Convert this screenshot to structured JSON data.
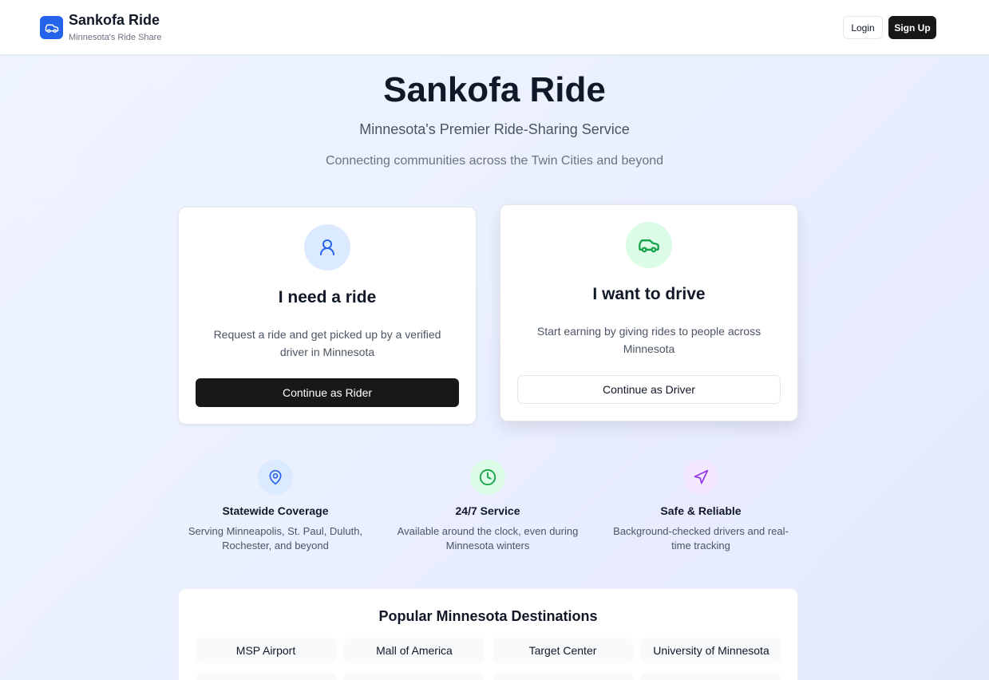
{
  "header": {
    "brand_name": "Sankofa Ride",
    "brand_tagline": "Minnesota's Ride Share",
    "logo_icon": "car-icon",
    "login_label": "Login",
    "signup_label": "Sign Up"
  },
  "hero": {
    "title": "Sankofa Ride",
    "subtitle": "Minnesota's Premier Ride-Sharing Service",
    "description": "Connecting communities across the Twin Cities and beyond"
  },
  "cards": {
    "rider": {
      "icon": "user-icon",
      "title": "I need a ride",
      "text": "Request a ride and get picked up by a verified driver in Minnesota",
      "button": "Continue as Rider"
    },
    "driver": {
      "icon": "car-icon",
      "title": "I want to drive",
      "text": "Start earning by giving rides to people across Minnesota",
      "button": "Continue as Driver"
    }
  },
  "features": [
    {
      "icon": "map-pin-icon",
      "title": "Statewide Coverage",
      "text": "Serving Minneapolis, St. Paul, Duluth, Rochester, and beyond"
    },
    {
      "icon": "clock-icon",
      "title": "24/7 Service",
      "text": "Available around the clock, even during Minnesota winters"
    },
    {
      "icon": "navigation-icon",
      "title": "Safe & Reliable",
      "text": "Background-checked drivers and real-time tracking"
    }
  ],
  "destinations": {
    "title": "Popular Minnesota Destinations",
    "items": [
      "MSP Airport",
      "Mall of America",
      "Target Center",
      "University of Minnesota"
    ]
  },
  "colors": {
    "brand_blue": "#2563eb",
    "dark_button": "#18181b",
    "rider_accent": "#2563eb",
    "driver_accent": "#16a34a",
    "safety_accent": "#9333ea"
  }
}
